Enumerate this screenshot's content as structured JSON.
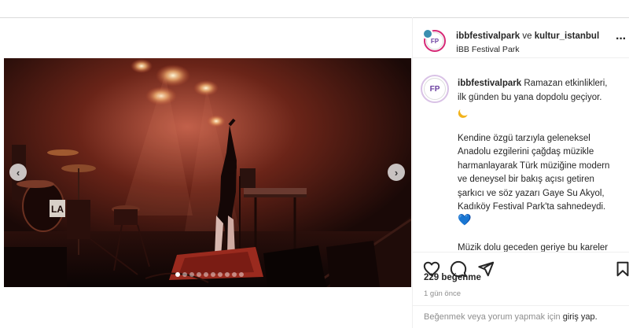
{
  "post": {
    "header": {
      "account": "ibbfestivalpark",
      "connector": " ve ",
      "coauthor": "kultur_istanbul",
      "location": "İBB Festival Park",
      "avatar_text": "FP"
    },
    "media": {
      "slide_count": 10,
      "active_slide": 0,
      "prev_label": "‹",
      "next_label": "›",
      "drum_brand": "LA"
    },
    "caption": {
      "username": "ibbfestivalpark",
      "intro": "Ramazan etkinlikleri, ilk günden bu yana dopdolu geçiyor.",
      "body": "Kendine özgü tarzıyla geleneksel Anadolu ezgilerini çağdaş müzikle harmanlayarak Türk müziğine modern ve deneysel bir bakış açısı getiren şarkıcı ve söz yazarı Gaye Su Akyol, Kadıköy Festival Park'ta sahnedeydi.",
      "heart": "💙",
      "continuation": "Müzik dolu geceden geriye bu kareler"
    },
    "likes": "229 beğenme",
    "time": "1 gün önce",
    "login_prompt": "Beğenmek veya yorum yapmak için",
    "login_link": "giriş yap."
  },
  "icons": {
    "like": "heart-outline-icon",
    "comment": "comment-icon",
    "share": "paper-plane-icon",
    "save": "bookmark-icon",
    "more": "more-horizontal-icon"
  }
}
